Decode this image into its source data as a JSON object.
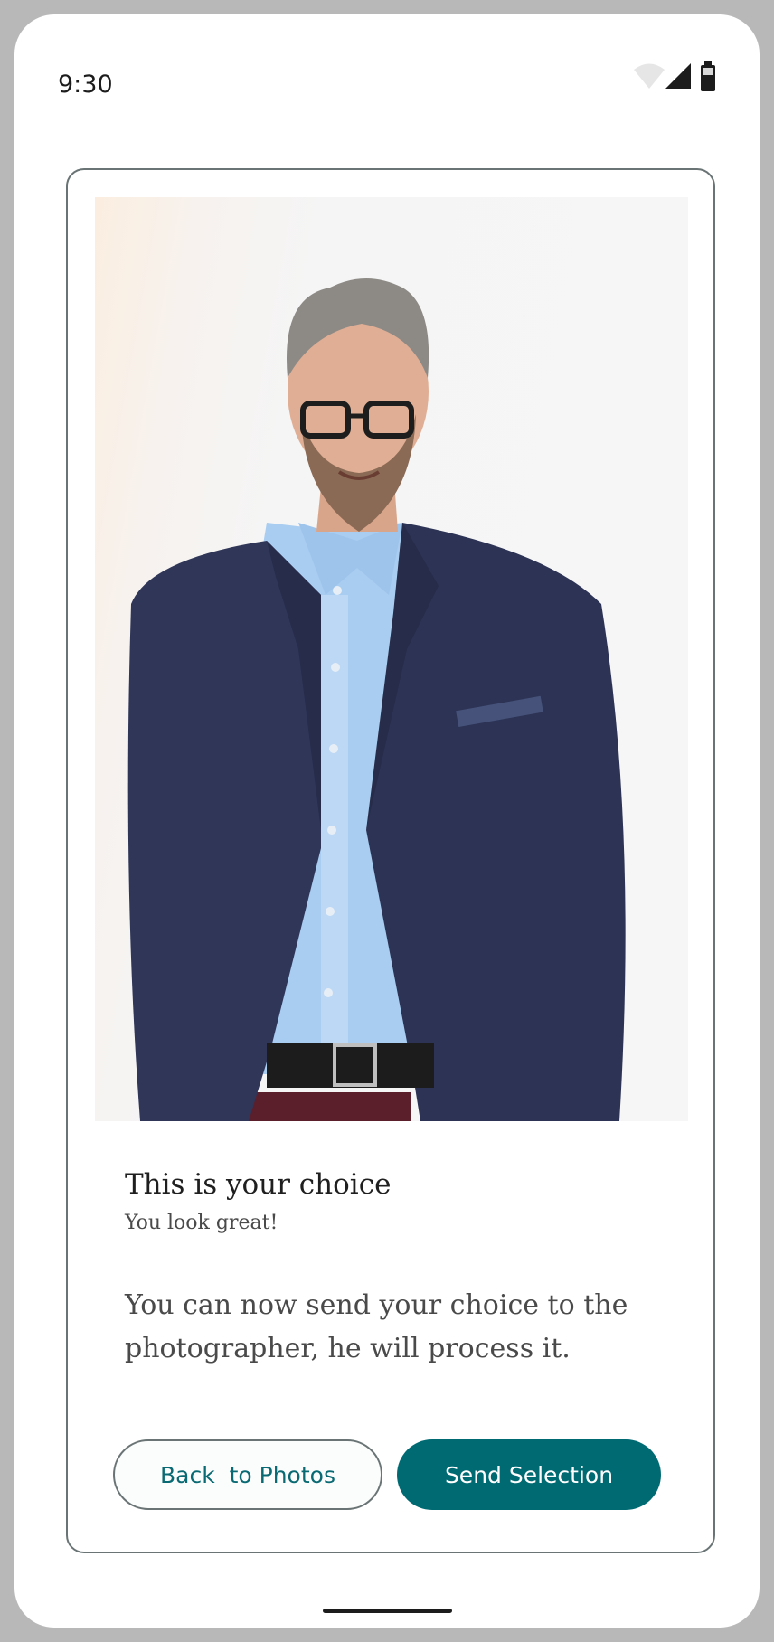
{
  "status_bar": {
    "time": "9:30",
    "icons": [
      "wifi-icon",
      "signal-icon",
      "battery-icon"
    ]
  },
  "card": {
    "image_alt": "Portrait photo of a man in a navy suit jacket and light blue shirt",
    "title": "This is your choice",
    "subtitle": "You look great!",
    "body": "You can now send your choice to the photographer, he will process it."
  },
  "buttons": {
    "back_label": "Back  to Photos",
    "send_label": "Send Selection"
  },
  "colors": {
    "primary": "#006a73",
    "outline": "#6a7474",
    "frame": "#b8b8b8"
  }
}
